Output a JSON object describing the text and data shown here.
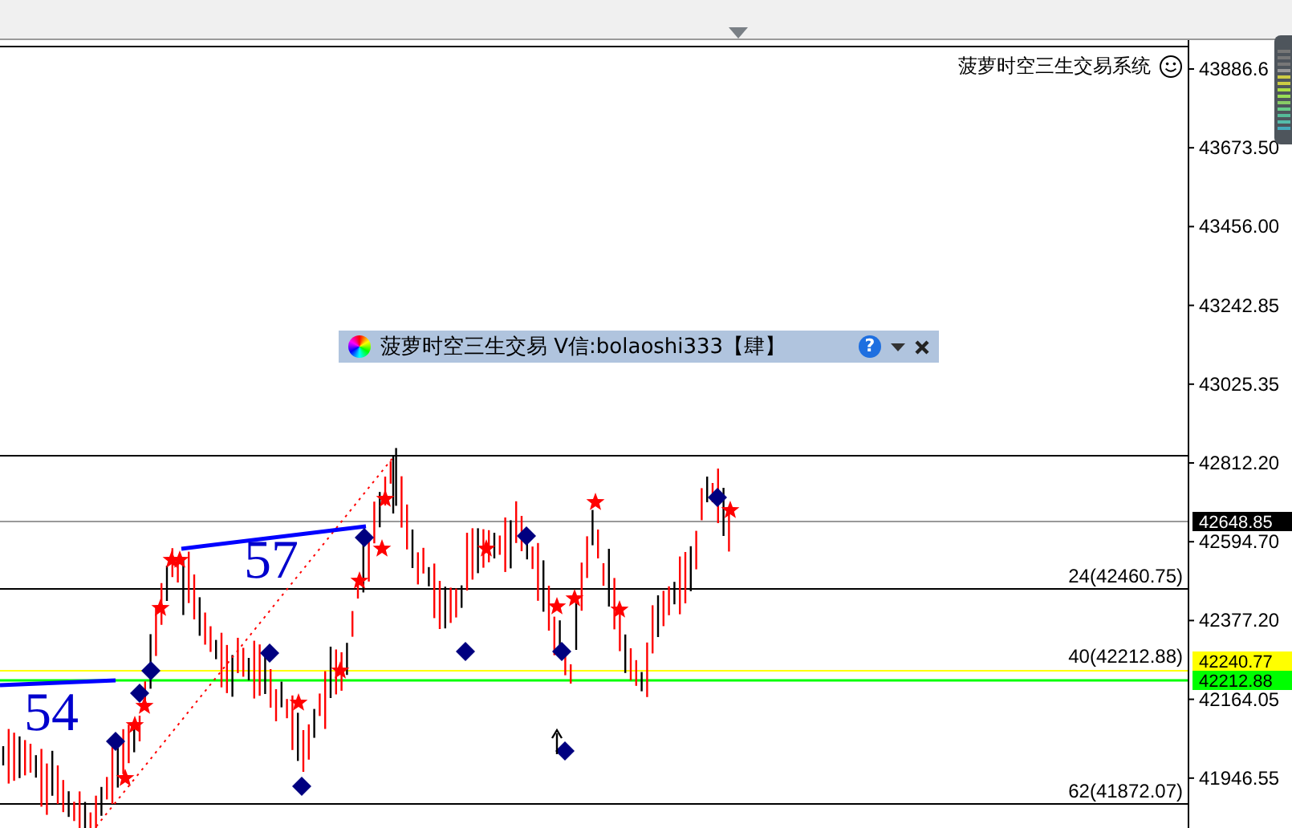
{
  "indicator_title": {
    "text": "菠萝时空三生交易系统"
  },
  "panel": {
    "title": "菠萝时空三生交易 V信:bolaoshi333【肆】",
    "help": "?"
  },
  "price_axis": {
    "ticks": [
      "43886.6",
      "43673.50",
      "43456.00",
      "43242.85",
      "43025.35",
      "42812.20",
      "42594.70",
      "42377.20",
      "42164.05",
      "41946.55"
    ]
  },
  "price_tags": [
    {
      "text": "42648.85",
      "color": "#000000"
    },
    {
      "text": "42240.77",
      "color": "#ffff00"
    },
    {
      "text": "42212.88",
      "color": "#00ff00"
    }
  ],
  "levels": [
    {
      "label": "24(42460.75)"
    },
    {
      "label": "40(42212.88)"
    },
    {
      "label": "62(41872.07)"
    }
  ],
  "wave_counts": [
    "54",
    "57"
  ]
}
